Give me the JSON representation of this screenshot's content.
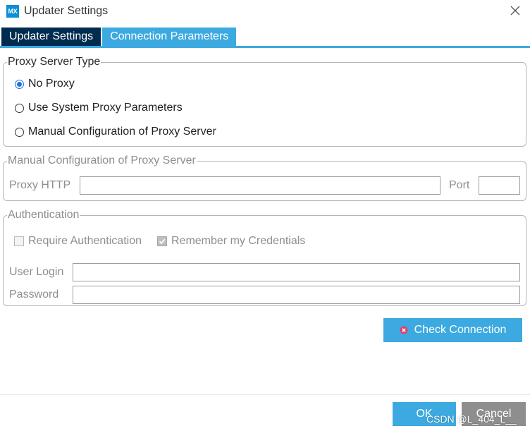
{
  "window": {
    "logo_text": "MX",
    "title": "Updater Settings",
    "close_icon": "close-icon"
  },
  "tabs": [
    {
      "label": "Updater Settings",
      "active": false
    },
    {
      "label": "Connection Parameters",
      "active": true
    }
  ],
  "proxy_type": {
    "legend": "Proxy Server Type",
    "options": [
      {
        "label": "No Proxy",
        "selected": true
      },
      {
        "label": "Use System Proxy Parameters",
        "selected": false
      },
      {
        "label": "Manual Configuration of Proxy Server",
        "selected": false
      }
    ]
  },
  "manual_config": {
    "legend": "Manual Configuration of Proxy Server",
    "proxy_http_label": "Proxy HTTP",
    "proxy_http_value": "",
    "port_label": "Port",
    "port_value": ""
  },
  "authentication": {
    "legend": "Authentication",
    "require_auth_label": "Require Authentication",
    "require_auth_checked": false,
    "remember_label": "Remember my Credentials",
    "remember_checked": true,
    "user_login_label": "User Login",
    "user_login_value": "",
    "password_label": "Password",
    "password_value": ""
  },
  "check_connection": {
    "label": "Check Connection",
    "icon": "error-circle-icon"
  },
  "footer": {
    "ok_label": "OK",
    "cancel_label": "Cancel"
  },
  "watermark": "CSDN @L_404_L__",
  "colors": {
    "accent": "#3caae0",
    "tab_dark": "#002c4f",
    "disabled": "#8e8e8e"
  }
}
